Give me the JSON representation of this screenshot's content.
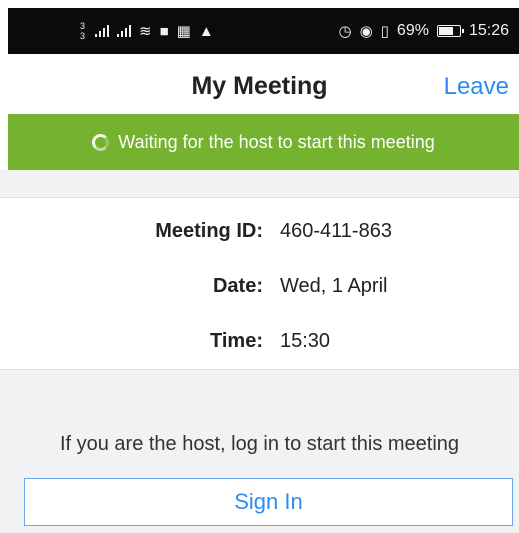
{
  "status_bar": {
    "sim_top": "3",
    "sim_bottom": "3",
    "battery_percent": "69%",
    "time": "15:26",
    "icons": [
      "signal-icon",
      "signal-icon",
      "wifi-icon",
      "video-icon",
      "sim-card-icon",
      "warning-icon",
      "alarm-icon",
      "eye-icon",
      "vibrate-icon",
      "battery-icon"
    ]
  },
  "header": {
    "title": "My Meeting",
    "leave_label": "Leave"
  },
  "banner": {
    "text": "Waiting for the host to start this meeting",
    "color": "#75b22f"
  },
  "meeting": {
    "id_label": "Meeting ID:",
    "id_value": "460-411-863",
    "date_label": "Date:",
    "date_value": "Wed, 1 April",
    "time_label": "Time:",
    "time_value": "15:30"
  },
  "host_prompt": "If you are the host, log in to start this meeting",
  "sign_in_label": "Sign In",
  "colors": {
    "accent": "#2d8cf0",
    "background": "#f2f2f4"
  }
}
